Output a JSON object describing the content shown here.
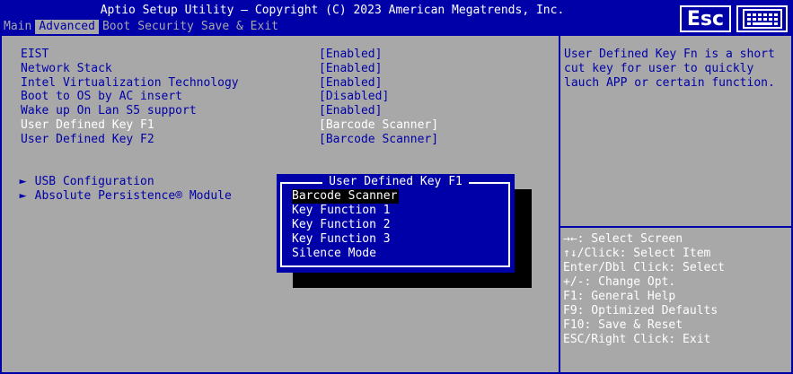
{
  "header": {
    "title": "Aptio Setup Utility – Copyright (C) 2023 American Megatrends, Inc.",
    "tabs": [
      {
        "label": "Main"
      },
      {
        "label": "Advanced"
      },
      {
        "label": "Boot"
      },
      {
        "label": "Security"
      },
      {
        "label": "Save & Exit"
      }
    ],
    "esc_label": "Esc",
    "keyboard_icon": "keyboard-icon"
  },
  "settings": [
    {
      "label": "EIST",
      "value": "[Enabled]"
    },
    {
      "label": "Network Stack",
      "value": "[Enabled]"
    },
    {
      "label": "Intel Virtualization Technology",
      "value": "[Enabled]"
    },
    {
      "label": "Boot to OS by AC insert",
      "value": "[Disabled]"
    },
    {
      "label": "Wake up On Lan S5 support",
      "value": "[Enabled]"
    },
    {
      "label": "User Defined Key F1",
      "value": "[Barcode Scanner]"
    },
    {
      "label": "User Defined Key F2",
      "value": "[Barcode Scanner]"
    }
  ],
  "submenus": [
    {
      "label": "USB Configuration"
    },
    {
      "label": "Absolute Persistence® Module"
    }
  ],
  "help": {
    "text": "User Defined Key Fn is a short cut key for user to quickly lauch APP or certain function.",
    "keys": [
      "→←: Select Screen",
      "↑↓/Click: Select Item",
      "Enter/Dbl Click: Select",
      "+/-: Change Opt.",
      "F1: General Help",
      "F9: Optimized Defaults",
      "F10: Save & Reset",
      "ESC/Right Click: Exit"
    ]
  },
  "popup": {
    "title": "User Defined Key F1",
    "options": [
      "Barcode Scanner",
      "Key Function 1",
      "Key Function 2",
      "Key Function 3",
      "Silence Mode"
    ],
    "selected": "Barcode Scanner"
  },
  "colors": {
    "bios_blue": "#0000a8",
    "bios_gray": "#a8a8a8",
    "white": "#ffffff",
    "black": "#000000"
  }
}
